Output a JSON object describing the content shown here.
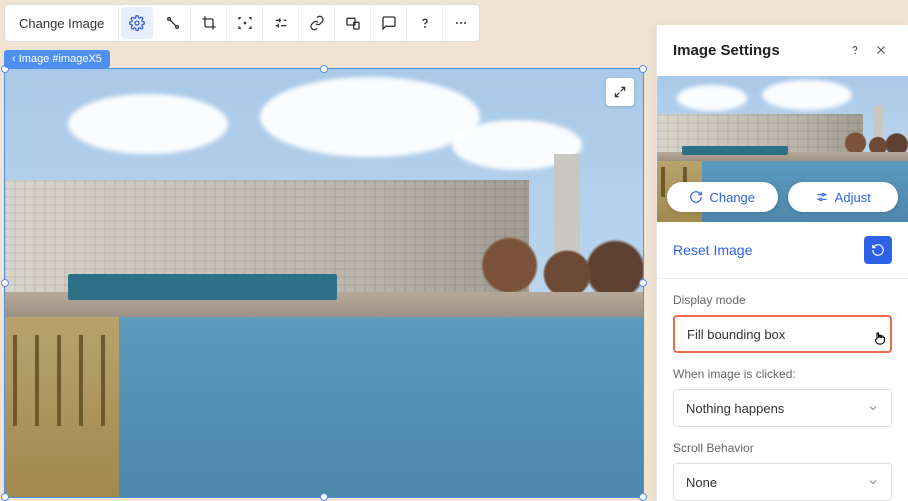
{
  "toolbar": {
    "change_image": "Change Image"
  },
  "breadcrumb": {
    "label": "Image #imageX5"
  },
  "panel": {
    "title": "Image Settings",
    "change_btn": "Change",
    "adjust_btn": "Adjust",
    "reset_link": "Reset Image",
    "display_mode_label": "Display mode",
    "display_mode_value": "Fill bounding box",
    "click_label": "When image is clicked:",
    "click_value": "Nothing happens",
    "scroll_label": "Scroll Behavior",
    "scroll_value": "None"
  }
}
